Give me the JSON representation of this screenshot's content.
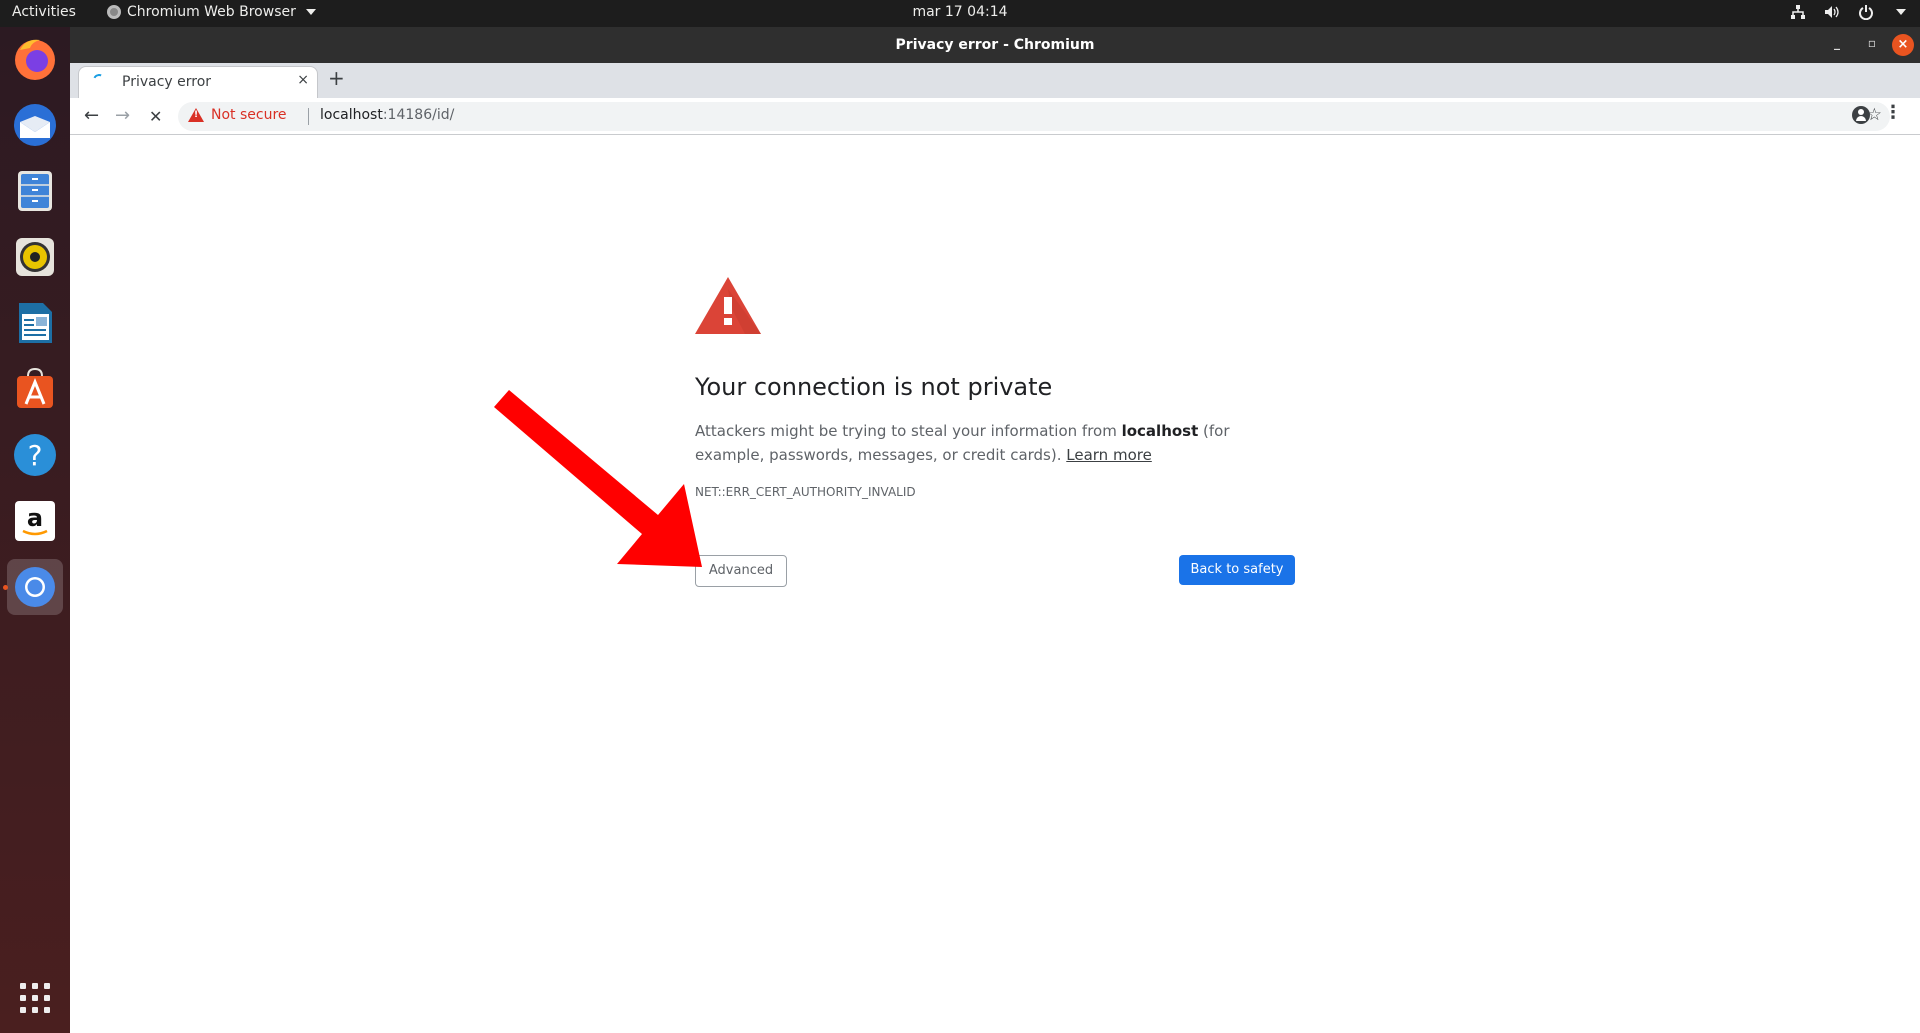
{
  "topbar": {
    "activities": "Activities",
    "app_name": "Chromium Web Browser",
    "clock": "mar 17  04:14",
    "status_icons": [
      "network-icon",
      "volume-icon",
      "power-icon"
    ]
  },
  "dock": {
    "items": [
      {
        "name": "firefox",
        "color": "#ff7139"
      },
      {
        "name": "thunderbird",
        "color": "#2a6fd6"
      },
      {
        "name": "files",
        "color": "#3f84d8"
      },
      {
        "name": "rhythmbox",
        "color": "#e8c400"
      },
      {
        "name": "libreoffice-writer",
        "color": "#1d6fa5"
      },
      {
        "name": "ubuntu-software",
        "color": "#e95420"
      },
      {
        "name": "help",
        "color": "#2a8fd8"
      },
      {
        "name": "amazon",
        "color": "#ffffff"
      },
      {
        "name": "chromium",
        "color": "#4a8ae8",
        "active": true
      }
    ]
  },
  "window": {
    "title": "Privacy error - Chromium",
    "minimize": "_",
    "maximize": "▫",
    "close": "×"
  },
  "tabs": [
    {
      "title": "Privacy error",
      "close": "×",
      "loading": true
    }
  ],
  "new_tab": "+",
  "toolbar": {
    "back": "←",
    "forward": "→",
    "stop": "✕",
    "security_label": "Not secure",
    "url_host": "localhost",
    "url_rest": ":14186/id/",
    "bookmark": "☆",
    "menu": "⋮"
  },
  "page": {
    "heading": "Your connection is not private",
    "explain_before": "Attackers might be trying to steal your information from ",
    "explain_host": "localhost",
    "explain_after": " (for example, passwords, messages, or credit cards). ",
    "learn_more": "Learn more",
    "error_code": "NET::ERR_CERT_AUTHORITY_INVALID",
    "advanced_button": "Advanced",
    "back_button": "Back to safety"
  },
  "colors": {
    "warning_red": "#d93025",
    "primary_blue": "#1a73e8",
    "annotation_arrow": "#ff0000"
  }
}
